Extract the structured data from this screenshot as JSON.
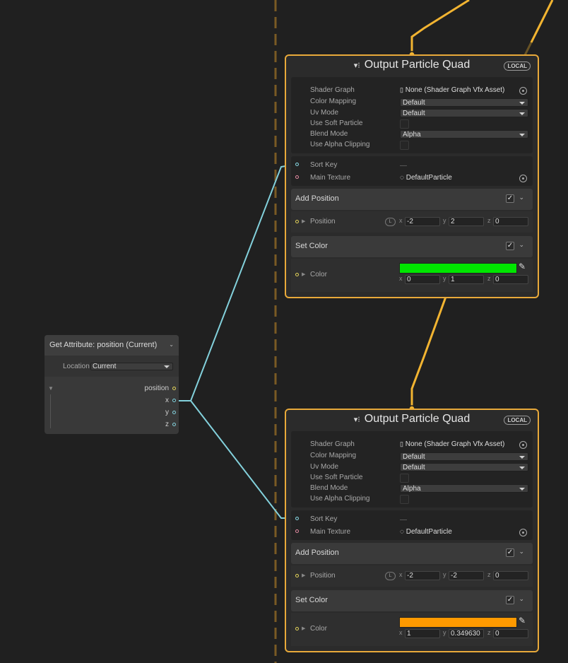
{
  "graph": {
    "contexts": [
      {
        "title": "Output Particle Quad",
        "badge": "LOCAL",
        "settings": {
          "shader_graph_label": "Shader Graph",
          "shader_graph_value": "None (Shader Graph Vfx Asset)",
          "color_mapping_label": "Color Mapping",
          "color_mapping_value": "Default",
          "uv_mode_label": "Uv Mode",
          "uv_mode_value": "Default",
          "soft_particle_label": "Use Soft Particle",
          "blend_mode_label": "Blend Mode",
          "blend_mode_value": "Alpha",
          "alpha_clipping_label": "Use Alpha Clipping"
        },
        "inputs": {
          "sort_key_label": "Sort Key",
          "main_texture_label": "Main Texture",
          "main_texture_value": "DefaultParticle"
        },
        "add_position": {
          "title": "Add Position",
          "check": "✓",
          "label": "Position",
          "space": "L",
          "x": "-2",
          "y": "2",
          "z": "0"
        },
        "set_color": {
          "title": "Set Color",
          "check": "✓",
          "label": "Color",
          "swatch": "#00e600",
          "x": "0",
          "y": "1",
          "z": "0"
        }
      },
      {
        "title": "Output Particle Quad",
        "badge": "LOCAL",
        "settings": {
          "shader_graph_label": "Shader Graph",
          "shader_graph_value": "None (Shader Graph Vfx Asset)",
          "color_mapping_label": "Color Mapping",
          "color_mapping_value": "Default",
          "uv_mode_label": "Uv Mode",
          "uv_mode_value": "Default",
          "soft_particle_label": "Use Soft Particle",
          "blend_mode_label": "Blend Mode",
          "blend_mode_value": "Alpha",
          "alpha_clipping_label": "Use Alpha Clipping"
        },
        "inputs": {
          "sort_key_label": "Sort Key",
          "main_texture_label": "Main Texture",
          "main_texture_value": "DefaultParticle"
        },
        "add_position": {
          "title": "Add Position",
          "check": "✓",
          "label": "Position",
          "space": "L",
          "x": "-2",
          "y": "-2",
          "z": "0"
        },
        "set_color": {
          "title": "Set Color",
          "check": "✓",
          "label": "Color",
          "swatch": "#ff9a00",
          "x": "1",
          "y": "0.349630",
          "z": "0"
        }
      }
    ],
    "operator": {
      "title": "Get Attribute: position (Current)",
      "location_label": "Location",
      "location_value": "Current",
      "outputs": [
        "position",
        "x",
        "y",
        "z"
      ]
    },
    "colors": {
      "background": "#202020",
      "context_border": "#e8a93a",
      "flow_wire": "#f2b431",
      "data_wire": "#83d1dc",
      "dashed_line": "#7a5a24"
    },
    "icons": {
      "context": "vfx-output-icon",
      "picker": "eyedropper-icon",
      "object_target": "object-picker-icon"
    }
  }
}
